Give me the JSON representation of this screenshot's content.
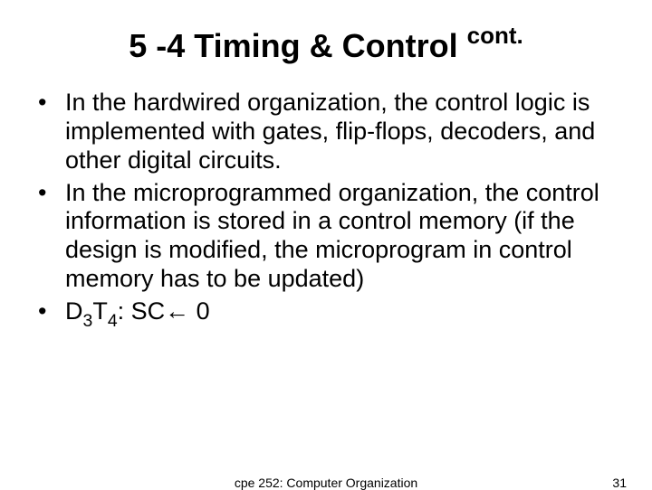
{
  "title": {
    "main": "5 -4 Timing & Control ",
    "super": "cont."
  },
  "bullets": [
    {
      "text": "In the hardwired organization, the control logic is implemented with gates, flip-flops, decoders, and other digital circuits."
    },
    {
      "text": "In the microprogrammed organization, the control information is stored in a control memory (if the design is modified, the microprogram in control memory has to be updated)"
    },
    {
      "parts": {
        "p1": "D",
        "s1": "3",
        "p2": "T",
        "s2": "4",
        "p3": ": SC← 0"
      }
    }
  ],
  "footer": {
    "course": "cpe 252: Computer Organization",
    "page": "31"
  }
}
